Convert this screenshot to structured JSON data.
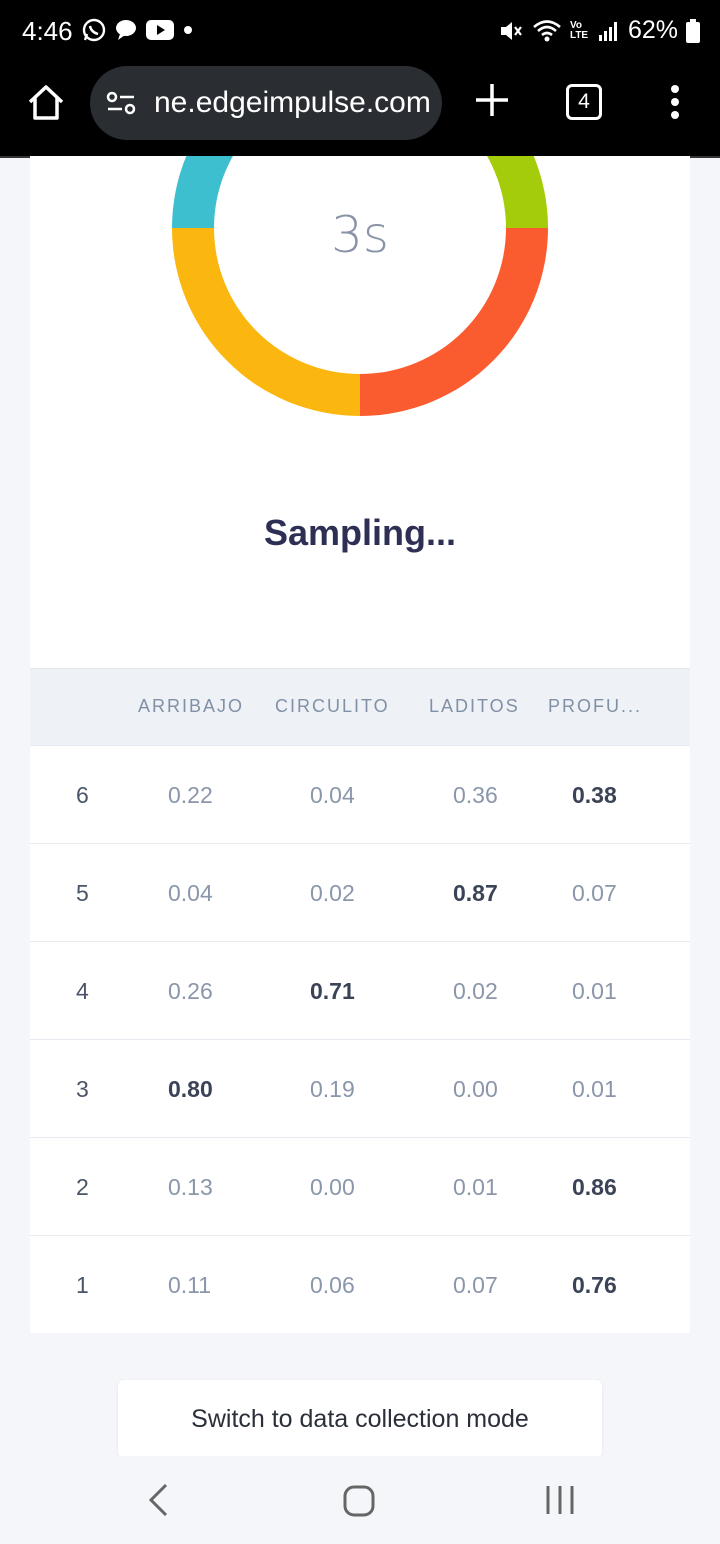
{
  "status_bar": {
    "time": "4:46",
    "battery": "62%",
    "icons_left": [
      "whatsapp-icon",
      "chat-icon",
      "youtube-icon",
      "dot-icon"
    ],
    "icons_right": [
      "mute-icon",
      "wifi-icon",
      "volte-icon",
      "signal-icon",
      "battery-icon"
    ],
    "volte_label": "Vo LTE"
  },
  "browser": {
    "url": "ne.edgeimpulse.com",
    "tab_count": "4"
  },
  "classifier": {
    "countdown": "3s",
    "status": "Sampling...",
    "ring_colors": [
      "#3ebfcf",
      "#a5cc0a",
      "#fa5c30",
      "#fbb70f"
    ]
  },
  "table": {
    "columns": [
      "ARRIBAJO",
      "CIRCULITO",
      "LADITOS",
      "PROFU..."
    ],
    "rows": [
      {
        "index": "6",
        "values": [
          "0.22",
          "0.04",
          "0.36",
          "0.38"
        ],
        "max_col": 3
      },
      {
        "index": "5",
        "values": [
          "0.04",
          "0.02",
          "0.87",
          "0.07"
        ],
        "max_col": 2
      },
      {
        "index": "4",
        "values": [
          "0.26",
          "0.71",
          "0.02",
          "0.01"
        ],
        "max_col": 1
      },
      {
        "index": "3",
        "values": [
          "0.80",
          "0.19",
          "0.00",
          "0.01"
        ],
        "max_col": 0
      },
      {
        "index": "2",
        "values": [
          "0.13",
          "0.00",
          "0.01",
          "0.86"
        ],
        "max_col": 3
      },
      {
        "index": "1",
        "values": [
          "0.11",
          "0.06",
          "0.07",
          "0.76"
        ],
        "max_col": 3
      }
    ]
  },
  "switch_button": "Switch to data collection mode",
  "nav": {
    "items": [
      "back-icon",
      "home-icon",
      "recent-apps-icon"
    ]
  }
}
